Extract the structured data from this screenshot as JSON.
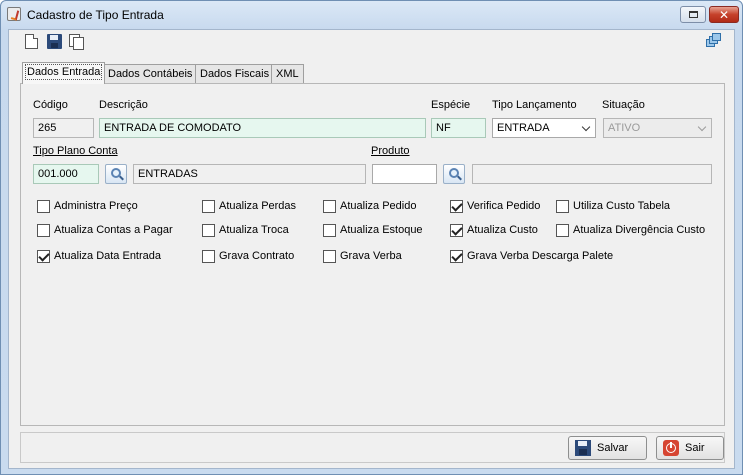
{
  "window": {
    "title": "Cadastro de Tipo Entrada",
    "close_glyph": "✕"
  },
  "toolbar": {
    "icons": [
      "new-document-icon",
      "save-icon",
      "copy-icon",
      "windows-icon"
    ]
  },
  "tabs": [
    {
      "label": "Dados Entrada",
      "active": true
    },
    {
      "label": "Dados Contábeis",
      "active": false
    },
    {
      "label": "Dados Fiscais",
      "active": false
    },
    {
      "label": "XML",
      "active": false
    }
  ],
  "form": {
    "codigo": {
      "label": "Código",
      "value": "265"
    },
    "descricao": {
      "label": "Descrição",
      "value": "ENTRADA DE COMODATO"
    },
    "especie": {
      "label": "Espécie",
      "value": "NF"
    },
    "tipo_lancamento": {
      "label": "Tipo Lançamento",
      "value": "ENTRADA"
    },
    "situacao": {
      "label": "Situação",
      "value": "ATIVO"
    },
    "tipo_plano_conta": {
      "label": "Tipo Plano Conta",
      "code": "001.000",
      "description": "ENTRADAS"
    },
    "produto": {
      "label": "Produto",
      "code": "",
      "description": ""
    }
  },
  "checkboxes": [
    {
      "label": "Administra Preço",
      "checked": false
    },
    {
      "label": "Atualiza Perdas",
      "checked": false
    },
    {
      "label": "Atualiza Pedido",
      "checked": false
    },
    {
      "label": "Verifica Pedido",
      "checked": true
    },
    {
      "label": "Utiliza Custo Tabela",
      "checked": false
    },
    {
      "label": "Atualiza Contas a Pagar",
      "checked": false
    },
    {
      "label": "Atualiza Troca",
      "checked": false
    },
    {
      "label": "Atualiza Estoque",
      "checked": false
    },
    {
      "label": "Atualiza Custo",
      "checked": true
    },
    {
      "label": "Atualiza Divergência Custo",
      "checked": false
    },
    {
      "label": "Atualiza Data Entrada",
      "checked": true
    },
    {
      "label": "Grava Contrato",
      "checked": false
    },
    {
      "label": "Grava Verba",
      "checked": false
    },
    {
      "label": "Grava Verba Descarga Palete",
      "checked": true
    }
  ],
  "footer": {
    "save_label": "Salvar",
    "exit_label": "Sair"
  },
  "colors": {
    "editable_field": "#e6f7ef",
    "close_button": "#c6412b"
  }
}
